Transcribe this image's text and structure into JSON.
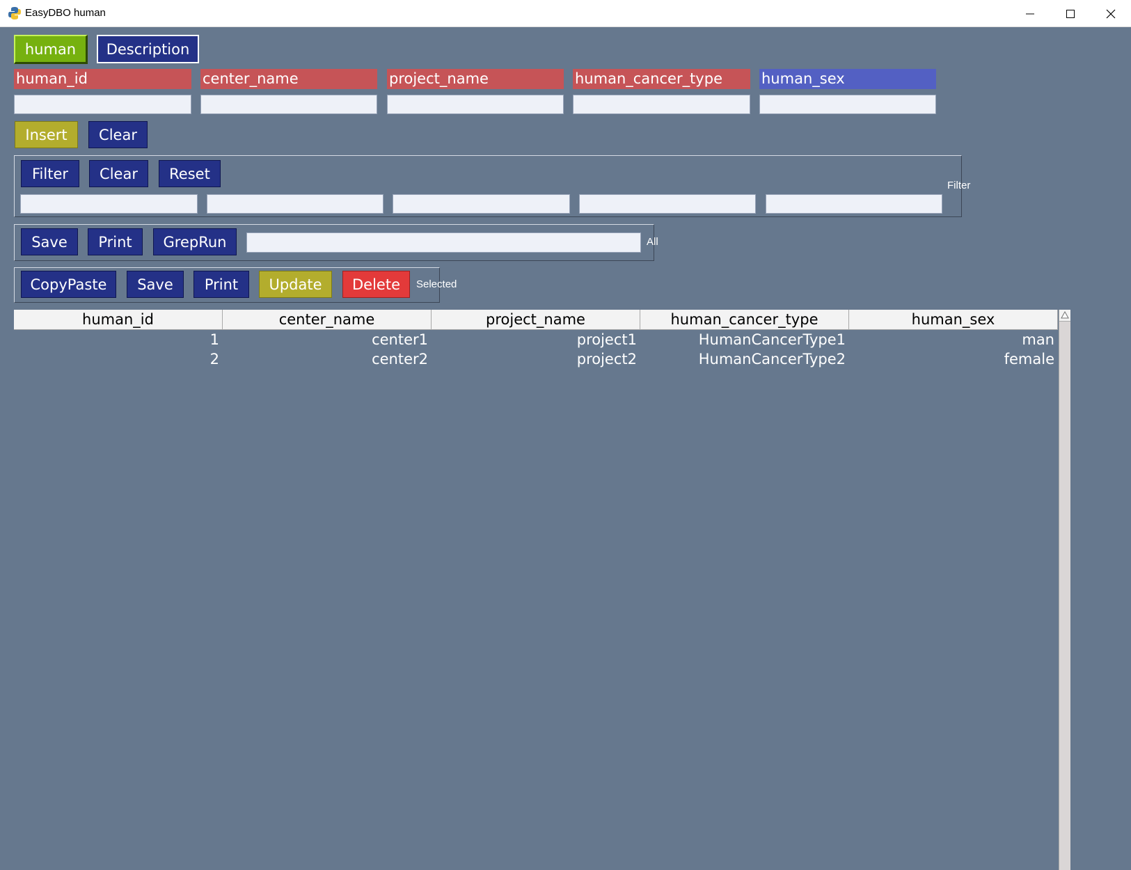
{
  "window": {
    "title": "EasyDBO human",
    "icon": "python-icon",
    "controls": [
      "minimize-icon",
      "maximize-icon",
      "close-icon"
    ]
  },
  "tabs": [
    {
      "label": "human",
      "active": true
    },
    {
      "label": "Description",
      "active": false
    }
  ],
  "fields": [
    {
      "label": "human_id",
      "color": "#c65457",
      "value": ""
    },
    {
      "label": "center_name",
      "color": "#c65457",
      "value": ""
    },
    {
      "label": "project_name",
      "color": "#c65457",
      "value": ""
    },
    {
      "label": "human_cancer_type",
      "color": "#c65457",
      "value": ""
    },
    {
      "label": "human_sex",
      "color": "#5360c3",
      "value": ""
    }
  ],
  "insert_bar": {
    "insert": "Insert",
    "clear": "Clear"
  },
  "filter_group": {
    "caption": "Filter",
    "buttons": {
      "filter": "Filter",
      "clear": "Clear",
      "reset": "Reset"
    },
    "inputs": [
      "",
      "",
      "",
      "",
      ""
    ]
  },
  "all_group": {
    "caption": "All",
    "buttons": {
      "save": "Save",
      "print": "Print",
      "greprun": "GrepRun"
    },
    "grep_value": ""
  },
  "selected_group": {
    "caption": "Selected",
    "buttons": {
      "copypaste": "CopyPaste",
      "save": "Save",
      "print": "Print",
      "update": "Update",
      "delete": "Delete"
    }
  },
  "table": {
    "columns": [
      "human_id",
      "center_name",
      "project_name",
      "human_cancer_type",
      "human_sex"
    ],
    "rows": [
      [
        "1",
        "center1",
        "project1",
        "HumanCancerType1",
        "man"
      ],
      [
        "2",
        "center2",
        "project2",
        "HumanCancerType2",
        "female"
      ]
    ]
  },
  "colors": {
    "background": "#66788e",
    "button_navy": "#243187",
    "button_olive": "#b3ad2d",
    "button_red": "#e33a3a",
    "button_green": "#76b10f"
  }
}
